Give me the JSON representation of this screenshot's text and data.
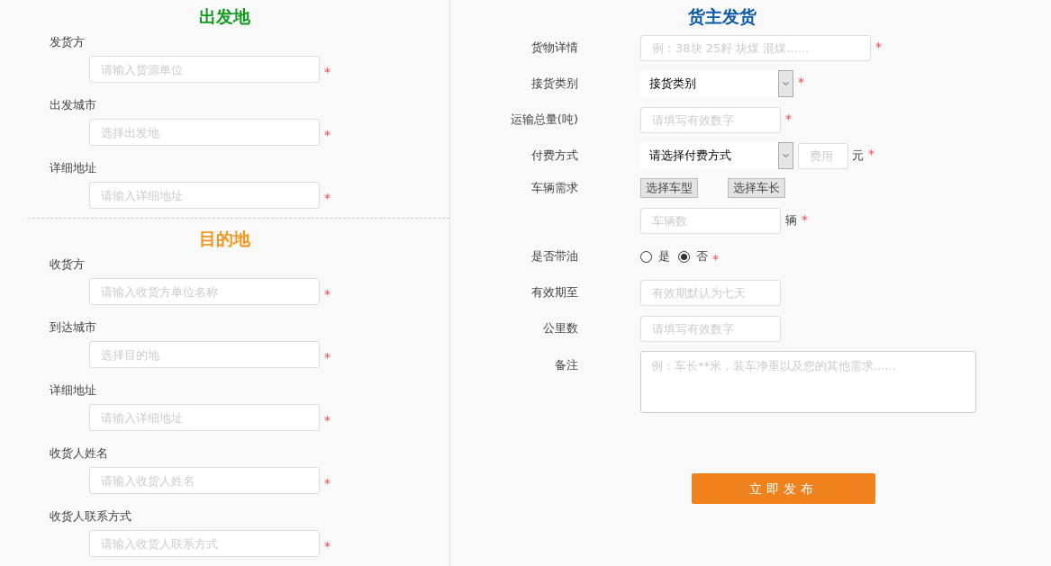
{
  "required_mark": "*",
  "sections": [
    {
      "title": "出发地",
      "color": "#0f9a1f",
      "fields": [
        {
          "label": "发货方",
          "placeholder": "请输入货源单位",
          "required": true
        },
        {
          "label": "出发城市",
          "placeholder": "选择出发地",
          "required": true
        },
        {
          "label": "详细地址",
          "placeholder": "请输入详细地址",
          "required": true
        }
      ]
    },
    {
      "title": "目的地",
      "color": "#f7941d",
      "fields": [
        {
          "label": "收货方",
          "placeholder": "请输入收货方单位名称",
          "required": true
        },
        {
          "label": "到达城市",
          "placeholder": "选择目的地",
          "required": true
        },
        {
          "label": "详细地址",
          "placeholder": "请输入详细地址",
          "required": true
        },
        {
          "label": "收货人姓名",
          "placeholder": "请输入收货人姓名",
          "required": true
        },
        {
          "label": "收货人联系方式",
          "placeholder": "请输入收货人联系方式",
          "required": true
        }
      ]
    }
  ],
  "form": {
    "title": "货主发货",
    "rows": [
      {
        "kind": "wide_text",
        "label": "货物详情",
        "placeholder": "例：38块 25籽 块煤 混煤......",
        "required": true
      },
      {
        "kind": "select",
        "label": "接货类别",
        "value": "接货类别",
        "required": true
      },
      {
        "kind": "text",
        "label": "运输总量(吨)",
        "placeholder": "请填写有效数字",
        "required": true
      },
      {
        "kind": "select_fee",
        "label": "付费方式",
        "value": "请选择付费方式",
        "fee_placeholder": "费用",
        "unit": "元",
        "required": true
      },
      {
        "kind": "buttons",
        "label": "车辆需求",
        "buttons": [
          "选择车型",
          "选择车长"
        ]
      },
      {
        "kind": "count",
        "placeholder": "车辆数",
        "unit": "辆",
        "required": true
      },
      {
        "kind": "radio",
        "label": "是否带油",
        "options": [
          {
            "label": "是",
            "selected": false
          },
          {
            "label": "否",
            "selected": true
          }
        ],
        "required": true
      },
      {
        "kind": "text",
        "label": "有效期至",
        "placeholder": "有效期默认为七天"
      },
      {
        "kind": "text",
        "label": "公里数",
        "placeholder": "请填写有效数字"
      },
      {
        "kind": "textarea",
        "label": "备注",
        "placeholder": "例：车长**米，装车净重以及您的其他需求......"
      }
    ],
    "submit": "立即发布"
  }
}
